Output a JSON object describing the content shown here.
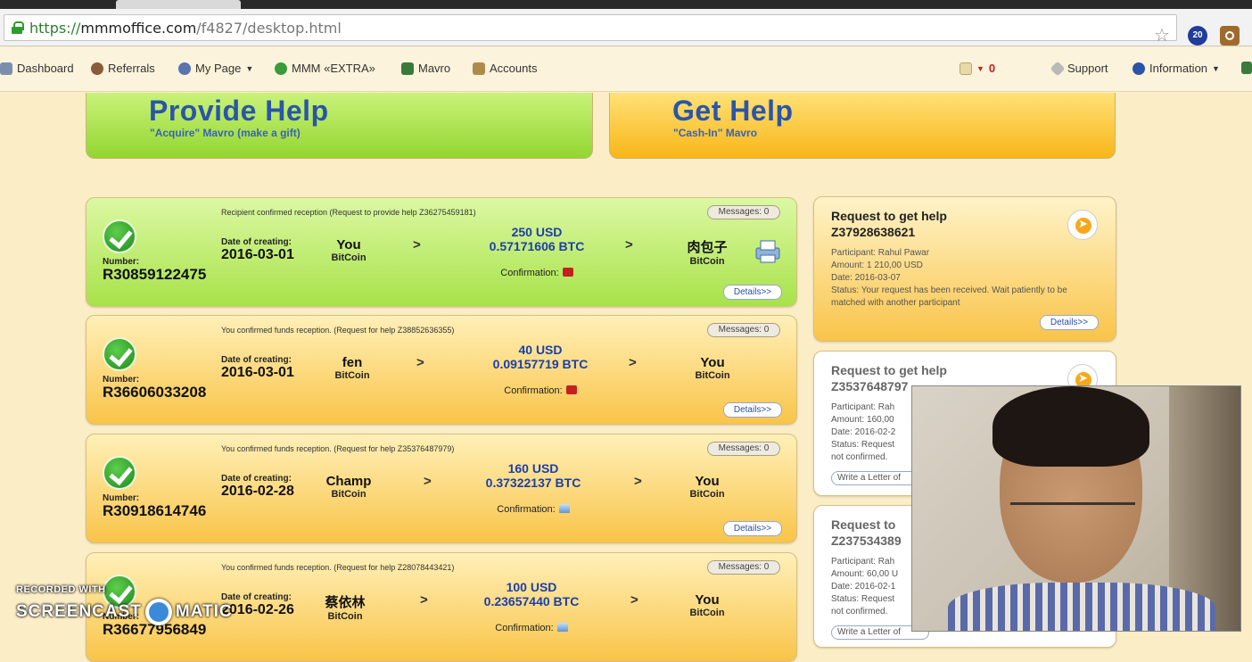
{
  "browser": {
    "url_proto": "https://",
    "url_host": "mmmoffice.com",
    "url_path": "/f4827/desktop.html",
    "ext1_label": "20"
  },
  "nav": {
    "items": [
      {
        "label": "Dashboard",
        "icon": "dashboard-icon",
        "color": "#7a8fb0"
      },
      {
        "label": "Referrals",
        "icon": "people-icon",
        "color": "#8a5c3a"
      },
      {
        "label": "My Page",
        "icon": "user-icon",
        "color": "#5a74b0"
      },
      {
        "label": "MMM «EXTRA»",
        "icon": "extra-g-icon",
        "color": "#3a9b3a"
      },
      {
        "label": "Mavro",
        "icon": "mavro-icon",
        "color": "#3a7a3a"
      },
      {
        "label": "Accounts",
        "icon": "accounts-icon",
        "color": "#b08a4a"
      }
    ],
    "mail_count": "0",
    "support": "Support",
    "information": "Information"
  },
  "provide_help": {
    "title": "Provide Help",
    "subtitle": "\"Acquire\" Mavro (make a gift)"
  },
  "get_help": {
    "title": "Get Help",
    "subtitle": "\"Cash-In\" Mavro"
  },
  "transactions": [
    {
      "status": "Recipient confirmed reception (Request to provide help Z36275459181)",
      "messages": "Messages: 0",
      "number_label": "Number:",
      "number": "R30859122475",
      "date_label": "Date of creating:",
      "date": "2016-03-01",
      "from_name": "You",
      "from_currency": "BitCoin",
      "usd": "250 USD",
      "btc": "0.57171606 BTC",
      "confirmation": "Confirmation:",
      "to_name": "肉包子",
      "to_currency": "BitCoin",
      "details": "Details>>",
      "theme": "green"
    },
    {
      "status": "You confirmed funds reception. (Request for help Z38852636355)",
      "messages": "Messages: 0",
      "number_label": "Number:",
      "number": "R36606033208",
      "date_label": "Date of creating:",
      "date": "2016-03-01",
      "from_name": "fen",
      "from_currency": "BitCoin",
      "usd": "40 USD",
      "btc": "0.09157719 BTC",
      "confirmation": "Confirmation:",
      "to_name": "You",
      "to_currency": "BitCoin",
      "details": "Details>>",
      "theme": "orange"
    },
    {
      "status": "You confirmed funds reception. (Request for help Z35376487979)",
      "messages": "Messages: 0",
      "number_label": "Number:",
      "number": "R30918614746",
      "date_label": "Date of creating:",
      "date": "2016-02-28",
      "from_name": "Champ",
      "from_currency": "BitCoin",
      "usd": "160 USD",
      "btc": "0.37322137 BTC",
      "confirmation": "Confirmation:",
      "to_name": "You",
      "to_currency": "BitCoin",
      "details": "Details>>",
      "theme": "orange"
    },
    {
      "status": "You confirmed funds reception. (Request for help Z28078443421)",
      "messages": "Messages: 0",
      "number_label": "Number:",
      "number": "R36677956849",
      "date_label": "Date of creating:",
      "date": "2016-02-26",
      "from_name": "蔡依林",
      "from_currency": "BitCoin",
      "usd": "100 USD",
      "btc": "0.23657440 BTC",
      "confirmation": "Confirmation:",
      "to_name": "You",
      "to_currency": "BitCoin",
      "details": "Details>>",
      "theme": "orange"
    }
  ],
  "requests": [
    {
      "title": "Request to get help",
      "id": "Z37928638621",
      "participant": "Participant: Rahul Pawar",
      "amount": "Amount: 1 210,00 USD",
      "date": "Date: 2016-03-07",
      "status": "Status: Your request has been received. Wait patiently to be matched with another participant",
      "details": "Details>>"
    },
    {
      "title": "Request to get help",
      "id": "Z3537648797",
      "participant": "Participant: Rah",
      "amount": "Amount: 160,00",
      "date": "Date: 2016-02-2",
      "status": "Status: Request",
      "status2": "not confirmed.",
      "letter": "Write a Letter of"
    },
    {
      "title": "Request to",
      "id": "Z237534389",
      "participant": "Participant: Rah",
      "amount": "Amount: 60,00 U",
      "date": "Date: 2016-02-1",
      "status": "Status: Request",
      "status2": "not confirmed.",
      "letter": "Write a Letter of"
    }
  ],
  "watermark": {
    "line1": "RECORDED WITH",
    "line2a": "SCREENCAST",
    "line2b": "MATIC"
  }
}
